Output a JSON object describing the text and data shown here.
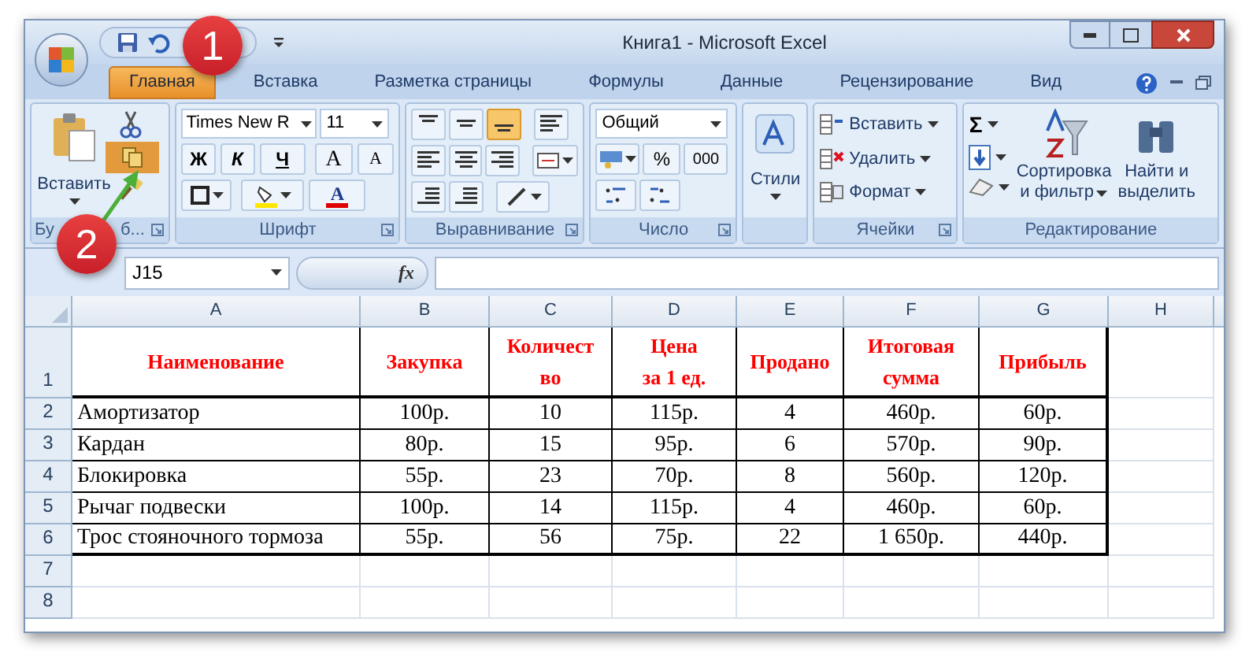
{
  "window": {
    "title": "Книга1 - Microsoft Excel"
  },
  "annotations": [
    {
      "label": "1"
    },
    {
      "label": "2"
    }
  ],
  "tabs": [
    {
      "label": "Главная",
      "selected": true
    },
    {
      "label": "Вставка",
      "selected": false
    },
    {
      "label": "Разметка страницы",
      "selected": false
    },
    {
      "label": "Формулы",
      "selected": false
    },
    {
      "label": "Данные",
      "selected": false
    },
    {
      "label": "Рецензирование",
      "selected": false
    },
    {
      "label": "Вид",
      "selected": false
    }
  ],
  "clipboard": {
    "paste": "Вставить",
    "label_parts": [
      "Бу",
      "б..."
    ],
    "copy": {
      "selected": true
    }
  },
  "font": {
    "label": "Шрифт",
    "font_name": "Times New R",
    "font_size": "11",
    "bold": "Ж",
    "italic": "К",
    "underline": "Ч",
    "grow": "A",
    "shrink": "A",
    "font_color": "A"
  },
  "alignment": {
    "label": "Выравнивание",
    "vertical": [
      {
        "selected": false
      },
      {
        "selected": false
      },
      {
        "selected": true
      }
    ]
  },
  "number": {
    "label": "Число",
    "format": "Общий",
    "percent": "%",
    "thousands": "000"
  },
  "styles": {
    "label": "Стили"
  },
  "cells": {
    "label": "Ячейки",
    "items": [
      "Вставить",
      "Удалить",
      "Формат"
    ]
  },
  "editing": {
    "label": "Редактирование",
    "sort": [
      "Сортировка",
      "и фильтр"
    ],
    "find": [
      "Найти и",
      "выделить"
    ],
    "sum": "Σ"
  },
  "formula_bar": {
    "name_box": "J15",
    "function_label": "fx"
  },
  "sheet": {
    "columns": [
      "A",
      "B",
      "C",
      "D",
      "E",
      "F",
      "G",
      "H"
    ],
    "rows": [
      {
        "number": "1",
        "kind": "header",
        "cells": [
          "Наименование",
          "Закупка",
          "Количест\nво",
          "Цена\nза 1 ед.",
          "Продано",
          "Итоговая\nсумма",
          "Прибыль"
        ]
      },
      {
        "number": "2",
        "kind": "data",
        "cells": [
          "Амортизатор",
          "100р.",
          "10",
          "115р.",
          "4",
          "460р.",
          "60р."
        ]
      },
      {
        "number": "3",
        "kind": "data",
        "cells": [
          "Кардан",
          "80р.",
          "15",
          "95р.",
          "6",
          "570р.",
          "90р."
        ]
      },
      {
        "number": "4",
        "kind": "data",
        "cells": [
          "Блокировка",
          "55р.",
          "23",
          "70р.",
          "8",
          "560р.",
          "120р."
        ]
      },
      {
        "number": "5",
        "kind": "data",
        "cells": [
          "Рычаг подвески",
          "100р.",
          "14",
          "115р.",
          "4",
          "460р.",
          "60р."
        ]
      },
      {
        "number": "6",
        "kind": "data",
        "cells": [
          "Трос стояночного тормоза",
          "55р.",
          "56",
          "75р.",
          "22",
          "1 650р.",
          "440р."
        ]
      },
      {
        "number": "7",
        "kind": "empty",
        "cells": []
      },
      {
        "number": "8",
        "kind": "empty",
        "cells": []
      }
    ]
  }
}
